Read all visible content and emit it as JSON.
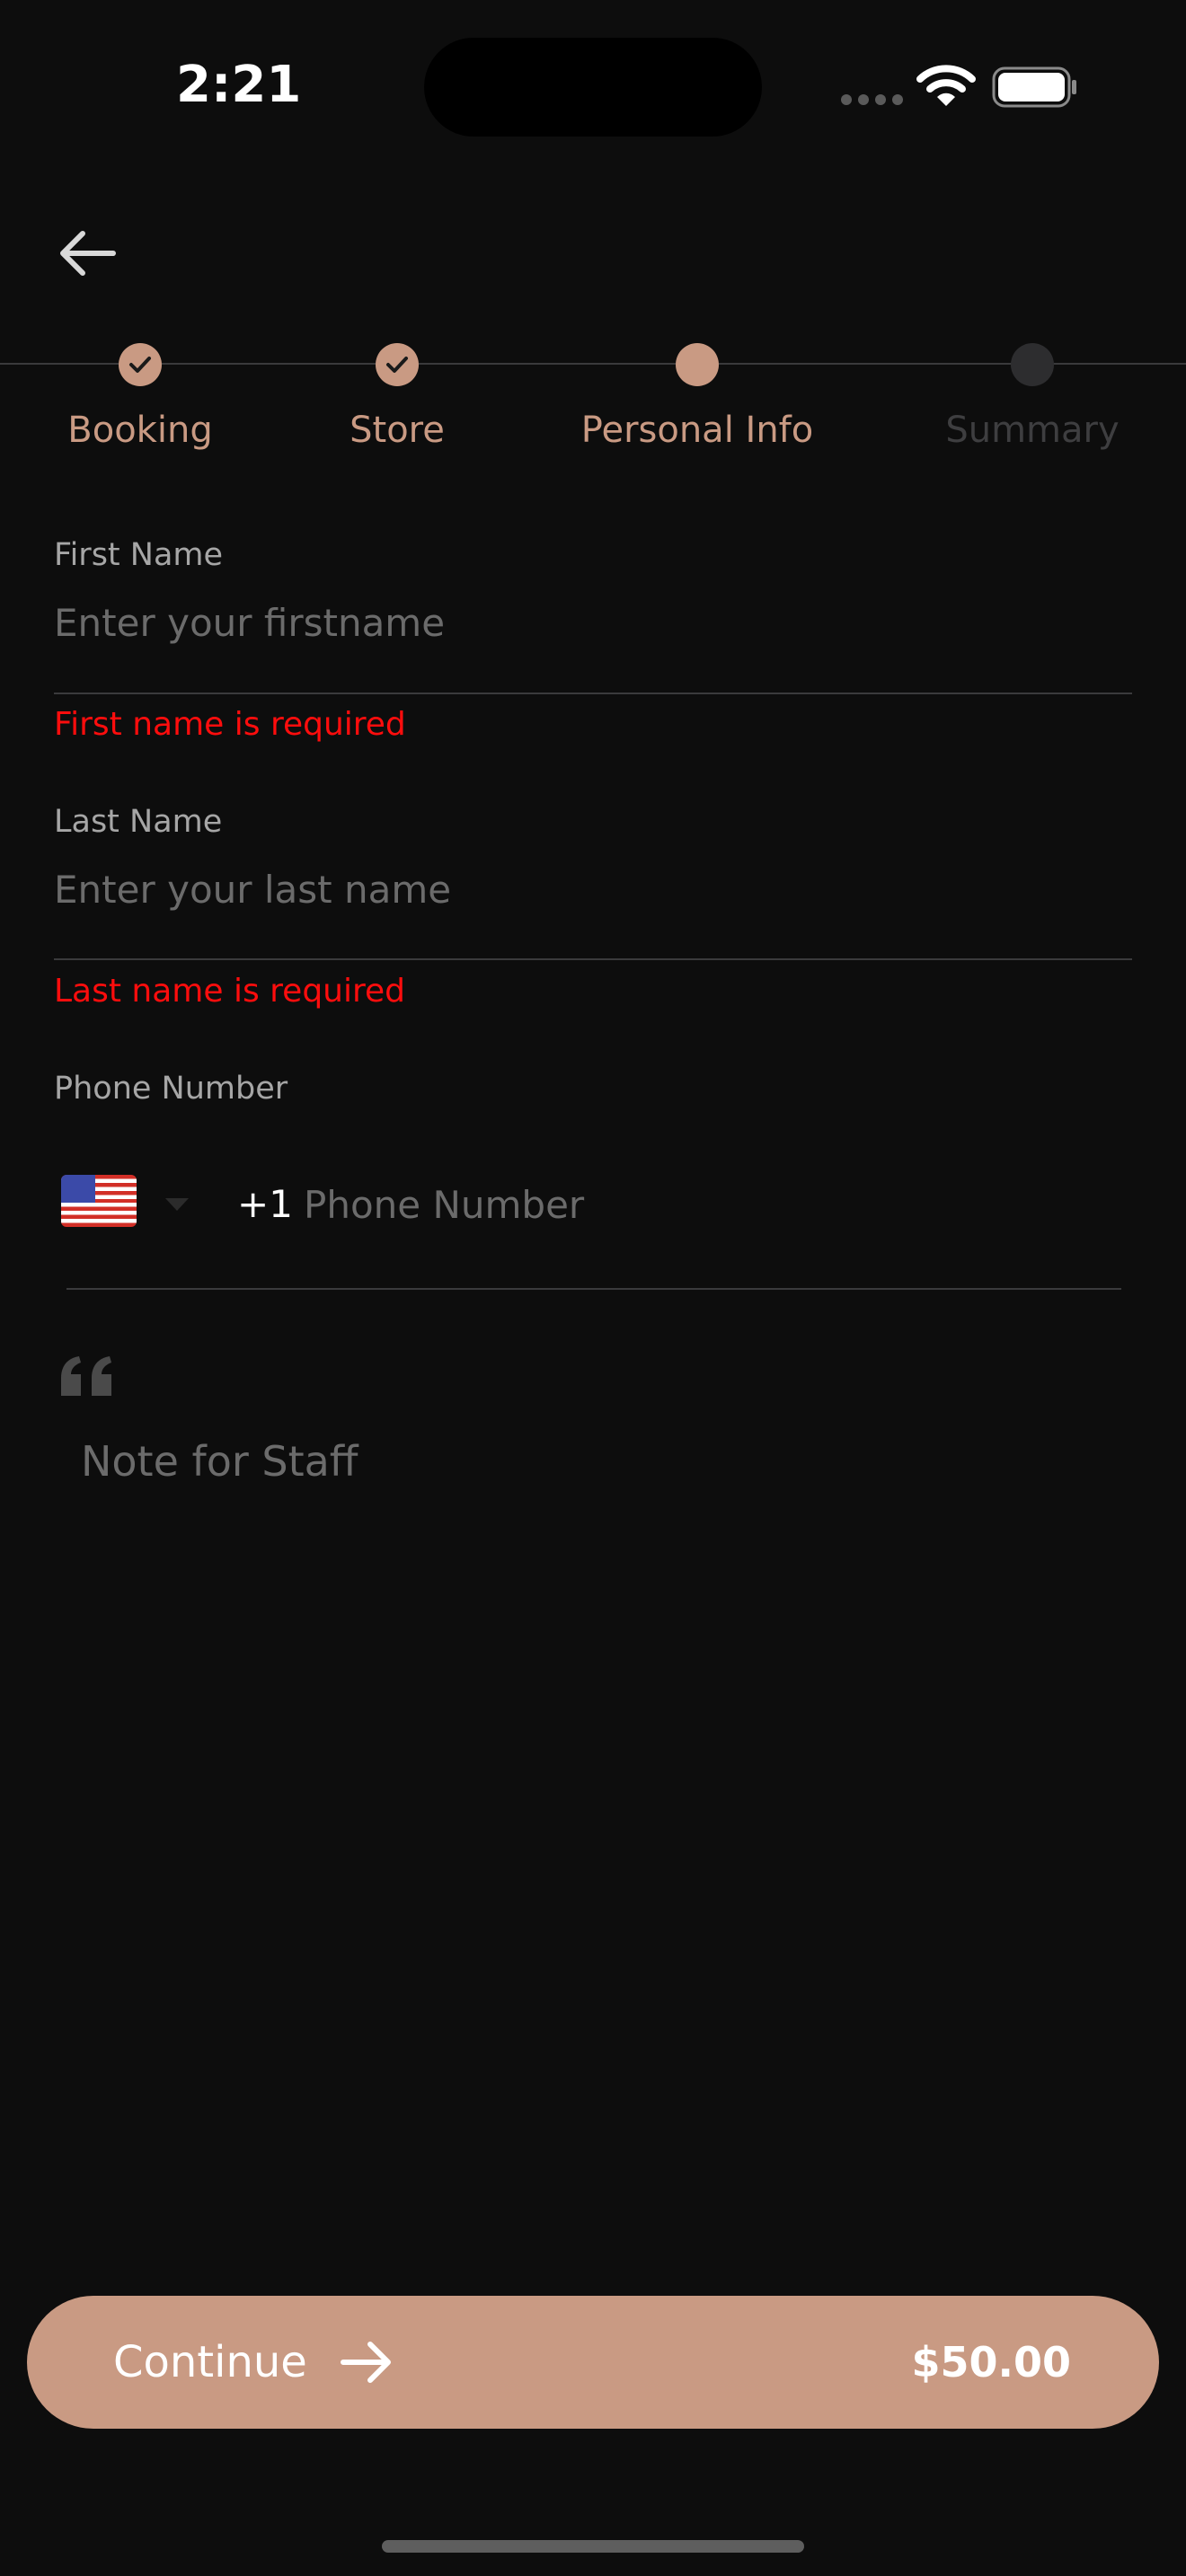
{
  "status_bar": {
    "time": "2:21"
  },
  "stepper": {
    "steps": [
      {
        "label": "Booking",
        "state": "done"
      },
      {
        "label": "Store",
        "state": "done"
      },
      {
        "label": "Personal Info",
        "state": "active"
      },
      {
        "label": "Summary",
        "state": "pending"
      }
    ]
  },
  "form": {
    "first_name": {
      "label": "First Name",
      "placeholder": "Enter your firstname",
      "value": "",
      "error": "First name is required"
    },
    "last_name": {
      "label": "Last Name",
      "placeholder": "Enter your last name",
      "value": "",
      "error": "Last name is required"
    },
    "phone": {
      "label": "Phone Number",
      "country_icon": "us-flag-icon",
      "dial_code": "+1",
      "placeholder": "Phone Number",
      "value": ""
    },
    "note": {
      "placeholder": "Note for Staff",
      "value": ""
    }
  },
  "footer": {
    "continue_label": "Continue",
    "price": "$50.00"
  },
  "colors": {
    "background": "#0d0d0d",
    "accent": "#c99a83",
    "error": "#ff0d0d",
    "inactive": "#3e3e40"
  }
}
